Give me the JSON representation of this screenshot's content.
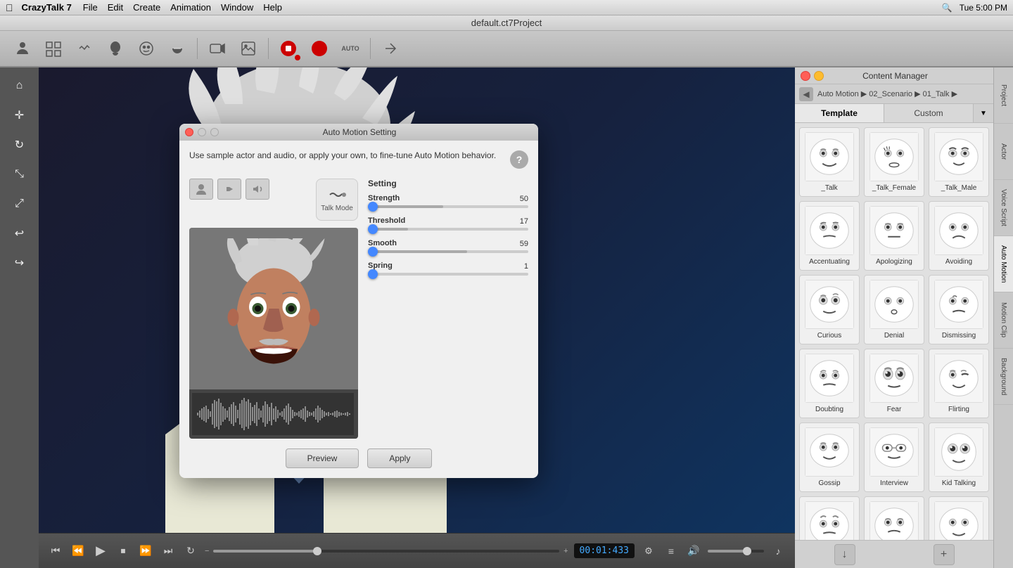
{
  "app": {
    "name": "CrazyTalk 7",
    "title": "default.ct7Project",
    "menuItems": [
      "File",
      "Edit",
      "Create",
      "Animation",
      "Window",
      "Help"
    ],
    "time": "Tue 5:00 PM"
  },
  "toolbar": {
    "buttons": [
      "actor",
      "scene",
      "motion",
      "head",
      "face",
      "mouth",
      "camera",
      "image",
      "record",
      "audio",
      "auto",
      "export"
    ]
  },
  "transport": {
    "timecode": "00:01:433"
  },
  "dialog": {
    "title": "Auto Motion Setting",
    "description": "Use sample actor and audio, or apply your own, to fine-tune Auto Motion behavior.",
    "settings": {
      "header": "Setting",
      "strength": {
        "label": "Strength",
        "value": 50,
        "percent": 47
      },
      "threshold": {
        "label": "Threshold",
        "value": 17,
        "percent": 25
      },
      "smooth": {
        "label": "Smooth",
        "value": 59,
        "percent": 62
      },
      "spring": {
        "label": "Spring",
        "value": 1,
        "percent": 5
      }
    },
    "talkModeLabel": "Talk Mode",
    "previewBtn": "Preview",
    "applyBtn": "Apply"
  },
  "contentManager": {
    "title": "Content Manager",
    "breadcrumb": "Auto Motion ▶ 02_Scenario ▶ 01_Talk ▶",
    "tabs": [
      "Template",
      "Custom"
    ],
    "activeTab": "Template",
    "sideTabs": [
      "Project",
      "Actor",
      "Voice Script",
      "Auto Motion",
      "Motion Clip",
      "Background"
    ],
    "activeTab2": "Auto Motion",
    "items": [
      {
        "label": "_Talk",
        "rowIdx": 0
      },
      {
        "label": "_Talk_Female",
        "rowIdx": 0
      },
      {
        "label": "_Talk_Male",
        "rowIdx": 0
      },
      {
        "label": "Accentuating",
        "rowIdx": 1
      },
      {
        "label": "Apologizing",
        "rowIdx": 1
      },
      {
        "label": "Avoiding",
        "rowIdx": 1
      },
      {
        "label": "Curious",
        "rowIdx": 2
      },
      {
        "label": "Denial",
        "rowIdx": 2
      },
      {
        "label": "Dismissing",
        "rowIdx": 2
      },
      {
        "label": "Doubting",
        "rowIdx": 3
      },
      {
        "label": "Fear",
        "rowIdx": 3
      },
      {
        "label": "Flirting",
        "rowIdx": 3
      },
      {
        "label": "Gossip",
        "rowIdx": 4
      },
      {
        "label": "Interview",
        "rowIdx": 4
      },
      {
        "label": "Kid Talking",
        "rowIdx": 4
      },
      {
        "label": "...",
        "rowIdx": 5
      },
      {
        "label": "...",
        "rowIdx": 5
      },
      {
        "label": "...",
        "rowIdx": 5
      }
    ]
  }
}
